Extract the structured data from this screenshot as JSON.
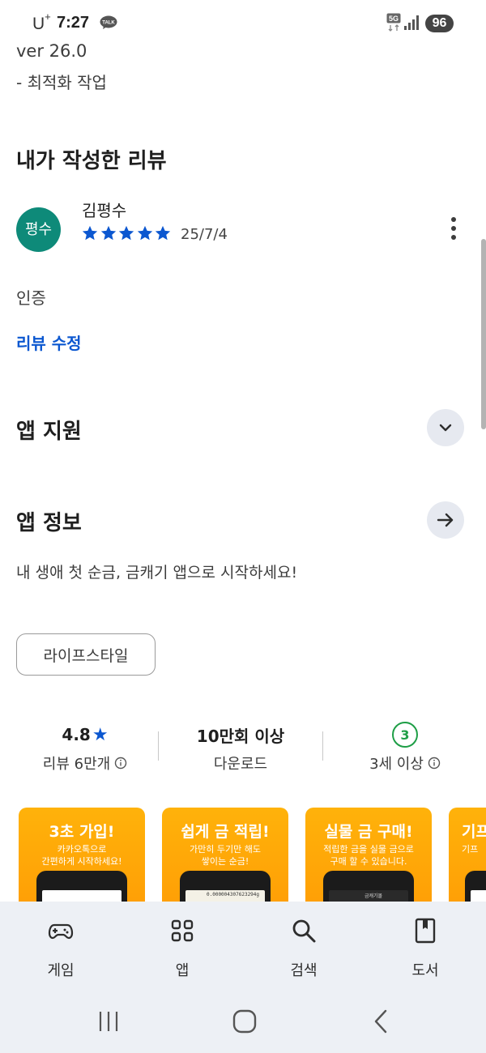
{
  "status_bar": {
    "carrier": "U",
    "carrier_sup": "+",
    "time": "7:27",
    "talk_badge": "TALK",
    "network": "5G",
    "battery": "96"
  },
  "update_notes": {
    "version": "ver 26.0",
    "note": "- 최적화 작업"
  },
  "my_review": {
    "heading": "내가 작성한 리뷰",
    "avatar_text": "평수",
    "reviewer_name": "김평수",
    "rating": 5,
    "date": "25/7/4",
    "body": "인증",
    "edit_label": "리뷰 수정"
  },
  "app_support": {
    "heading": "앱 지원",
    "icon": "chevron-down-icon"
  },
  "app_info": {
    "heading": "앱 정보",
    "icon": "arrow-right-icon",
    "description": "내 생애 첫 순금, 금캐기 앱으로 시작하세요!",
    "category_chip": "라이프스타일"
  },
  "stats": {
    "rating_value": "4.8",
    "rating_star": "★",
    "rating_label": "리뷰 6만개",
    "downloads_value": "10만회 이상",
    "downloads_label": "다운로드",
    "age_value": "3",
    "age_label": "3세 이상",
    "accent_color": "#0b57d0",
    "age_color": "#1e9e46"
  },
  "screenshots": [
    {
      "title": "3초 가입!",
      "line1": "카카오톡으로",
      "line2": "간편하게 시작하세요!",
      "screen_text": ""
    },
    {
      "title": "쉽게 금 적립!",
      "line1": "가만히 두기만 해도",
      "line2": "쌓이는 순금!",
      "screen_text": "0.000004307623294g"
    },
    {
      "title": "실물 금 구매!",
      "line1": "적립한 금을 실물 금으로",
      "line2": "구매 할 수 있습니다.",
      "screen_text": "금캐기몰"
    },
    {
      "title": "기프",
      "line1": "기프",
      "line2": "",
      "screen_text": ""
    }
  ],
  "bottom_nav": [
    {
      "label": "게임",
      "icon": "gamepad-icon"
    },
    {
      "label": "앱",
      "icon": "apps-grid-icon"
    },
    {
      "label": "검색",
      "icon": "search-icon"
    },
    {
      "label": "도서",
      "icon": "book-icon"
    }
  ],
  "system_nav": {
    "icons": [
      "recent-apps-icon",
      "home-icon",
      "back-icon"
    ]
  }
}
